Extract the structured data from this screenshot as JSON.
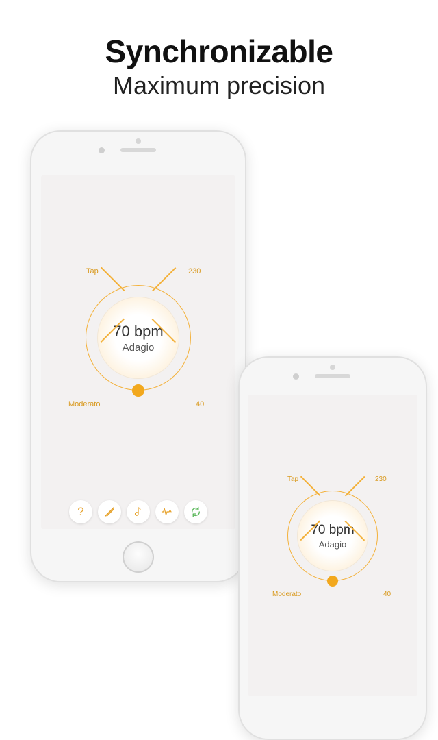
{
  "headline": {
    "title": "Synchronizable",
    "subtitle": "Maximum precision"
  },
  "accent_color": "#f2a81d",
  "sync_color": "#5cb85c",
  "dial": {
    "bpm_value": "70 bpm",
    "tempo_name": "Adagio",
    "labels": {
      "tap": "Tap",
      "max": "230",
      "min": "40",
      "style": "Moderato"
    }
  },
  "toolbar": {
    "help": "?",
    "sticks_icon": "sticks-icon",
    "note_icon": "note-icon",
    "wave_icon": "wave-icon",
    "sync_icon": "sync-icon"
  }
}
